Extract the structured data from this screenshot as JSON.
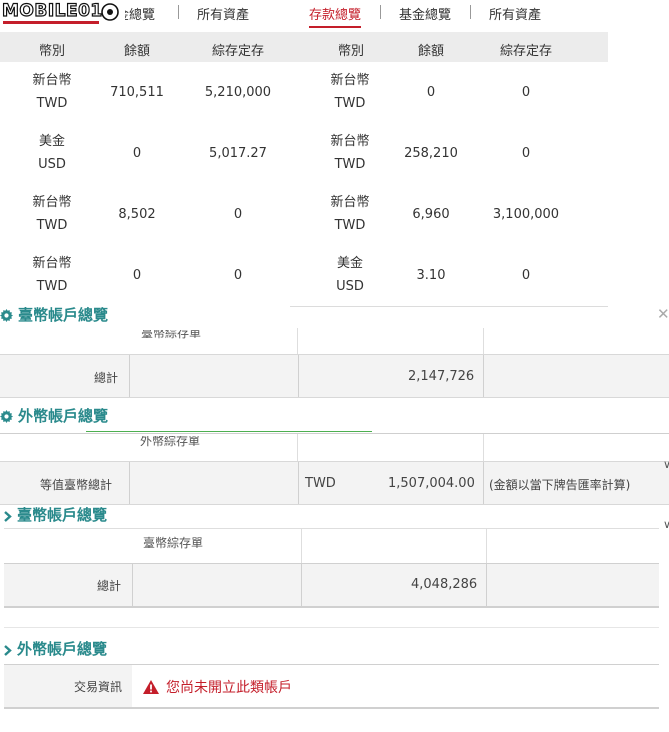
{
  "left_tabs": {
    "partial": "金總覽",
    "all_assets": "所有資產"
  },
  "logo": {
    "text": "MOBILE01"
  },
  "right_tabs": {
    "deposit": "存款總覽",
    "fund": "基金總覽",
    "all_assets": "所有資產"
  },
  "left_table": {
    "headers": [
      "幣別",
      "餘額",
      "綜存定存"
    ],
    "rows": [
      {
        "cur1": "新台幣",
        "cur2": "TWD",
        "balance": "710,511",
        "fixed": "5,210,000"
      },
      {
        "cur1": "美金",
        "cur2": "USD",
        "balance": "0",
        "fixed": "5,017.27"
      },
      {
        "cur1": "新台幣",
        "cur2": "TWD",
        "balance": "8,502",
        "fixed": "0"
      },
      {
        "cur1": "新台幣",
        "cur2": "TWD",
        "balance": "0",
        "fixed": "0"
      }
    ]
  },
  "right_table": {
    "headers": [
      "幣別",
      "餘額",
      "綜存定存"
    ],
    "rows": [
      {
        "cur1": "新台幣",
        "cur2": "TWD",
        "balance": "0",
        "fixed": "0"
      },
      {
        "cur1": "新台幣",
        "cur2": "TWD",
        "balance": "258,210",
        "fixed": "0"
      },
      {
        "cur1": "新台幣",
        "cur2": "TWD",
        "balance": "6,960",
        "fixed": "3,100,000"
      },
      {
        "cur1": "美金",
        "cur2": "USD",
        "balance": "3.10",
        "fixed": "0"
      }
    ]
  },
  "section1": {
    "title": "臺幣帳戶總覽",
    "partial_label": "臺幣綜存單",
    "total_label": "總計",
    "total_value": "2,147,726"
  },
  "section2": {
    "title": "外幣帳戶總覽",
    "partial_label": "外幣綜存單",
    "total_label": "等值臺幣總計",
    "currency": "TWD",
    "total_value": "1,507,004.00",
    "note": "(金額以當下牌告匯率計算)"
  },
  "section3": {
    "title": "臺幣帳戶總覽",
    "partial_label": "臺幣綜存單",
    "total_label": "總計",
    "total_value": "4,048,286"
  },
  "section4": {
    "title": "外幣帳戶總覽",
    "label": "交易資訊",
    "warning": "您尚未開立此類帳戶"
  },
  "colors": {
    "accent_red": "#c41e2a",
    "teal": "#2a8a8c",
    "header_bg": "#ececec"
  }
}
